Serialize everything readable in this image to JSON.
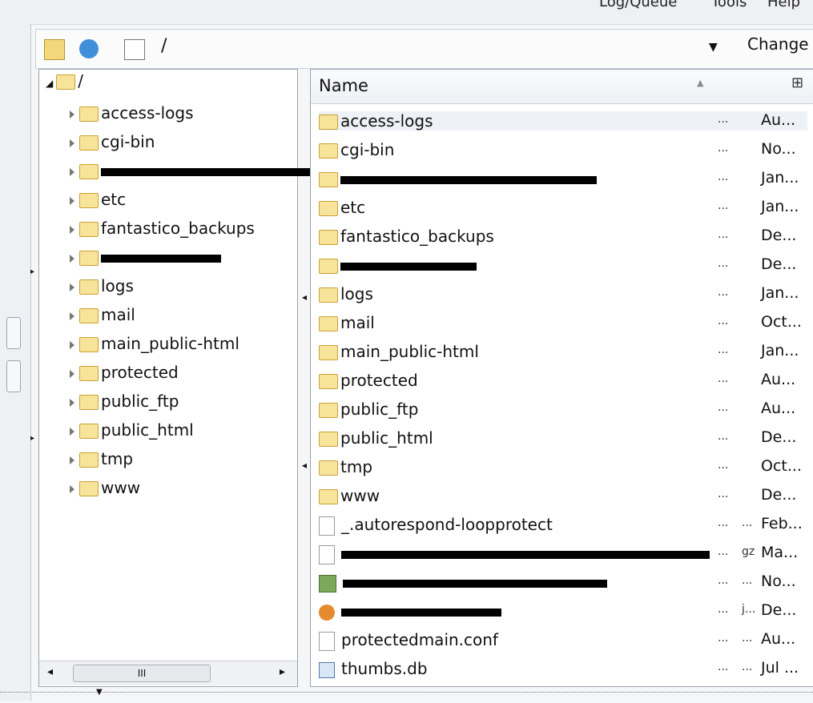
{
  "menu": {
    "items": [
      "Log/Queue",
      "Tools",
      "Help"
    ]
  },
  "toolbar": {
    "path": "/",
    "change_label": "Change"
  },
  "tree": {
    "root_label": "/",
    "items": [
      {
        "label": "access-logs"
      },
      {
        "label": "cgi-bin"
      },
      {
        "label": "",
        "redacted": true
      },
      {
        "label": "etc"
      },
      {
        "label": "fantastico_backups"
      },
      {
        "label": "",
        "redacted": true
      },
      {
        "label": "logs"
      },
      {
        "label": "mail"
      },
      {
        "label": "main_public-html"
      },
      {
        "label": "protected"
      },
      {
        "label": "public_ftp"
      },
      {
        "label": "public_html"
      },
      {
        "label": "tmp"
      },
      {
        "label": "www"
      }
    ],
    "scrollbar_thumb": "III"
  },
  "list": {
    "header_name": "Name",
    "rows": [
      {
        "icon": "folder",
        "name": "access-logs",
        "size": "...",
        "type": "",
        "date": "Au..."
      },
      {
        "icon": "folder",
        "name": "cgi-bin",
        "size": "...",
        "type": "",
        "date": "No..."
      },
      {
        "icon": "folder",
        "name": "",
        "redacted": true,
        "size": "...",
        "type": "",
        "date": "Jan..."
      },
      {
        "icon": "folder",
        "name": "etc",
        "size": "...",
        "type": "",
        "date": "Jan..."
      },
      {
        "icon": "folder",
        "name": "fantastico_backups",
        "size": "...",
        "type": "",
        "date": "De..."
      },
      {
        "icon": "folder",
        "name": "",
        "redacted": true,
        "size": "...",
        "type": "",
        "date": "De..."
      },
      {
        "icon": "folder",
        "name": "logs",
        "size": "...",
        "type": "",
        "date": "Jan..."
      },
      {
        "icon": "folder",
        "name": "mail",
        "size": "...",
        "type": "",
        "date": "Oct..."
      },
      {
        "icon": "folder",
        "name": "main_public-html",
        "size": "...",
        "type": "",
        "date": "Jan..."
      },
      {
        "icon": "folder",
        "name": "protected",
        "size": "...",
        "type": "",
        "date": "Au..."
      },
      {
        "icon": "folder",
        "name": "public_ftp",
        "size": "...",
        "type": "",
        "date": "Au..."
      },
      {
        "icon": "folder",
        "name": "public_html",
        "size": "...",
        "type": "",
        "date": "De..."
      },
      {
        "icon": "folder",
        "name": "tmp",
        "size": "...",
        "type": "",
        "date": "Oct..."
      },
      {
        "icon": "folder",
        "name": "www",
        "size": "...",
        "type": "",
        "date": "De..."
      },
      {
        "icon": "file",
        "name": "_.autorespond-loopprotect",
        "size": "...",
        "type": "...",
        "date": "Feb..."
      },
      {
        "icon": "file",
        "name": "",
        "redacted": true,
        "size": "...",
        "type": "gz",
        "date": "Ma..."
      },
      {
        "icon": "gif",
        "name": "",
        "redacted": true,
        "size": "...",
        "type": "...",
        "date": "No..."
      },
      {
        "icon": "jpg",
        "name": "",
        "redacted": true,
        "size": "...",
        "type": "j...",
        "date": "De..."
      },
      {
        "icon": "file",
        "name": "protectedmain.conf",
        "size": "...",
        "type": "...",
        "date": "Au..."
      },
      {
        "icon": "db",
        "name": "thumbs.db",
        "size": "...",
        "type": "...",
        "date": "Jul ..."
      }
    ]
  }
}
